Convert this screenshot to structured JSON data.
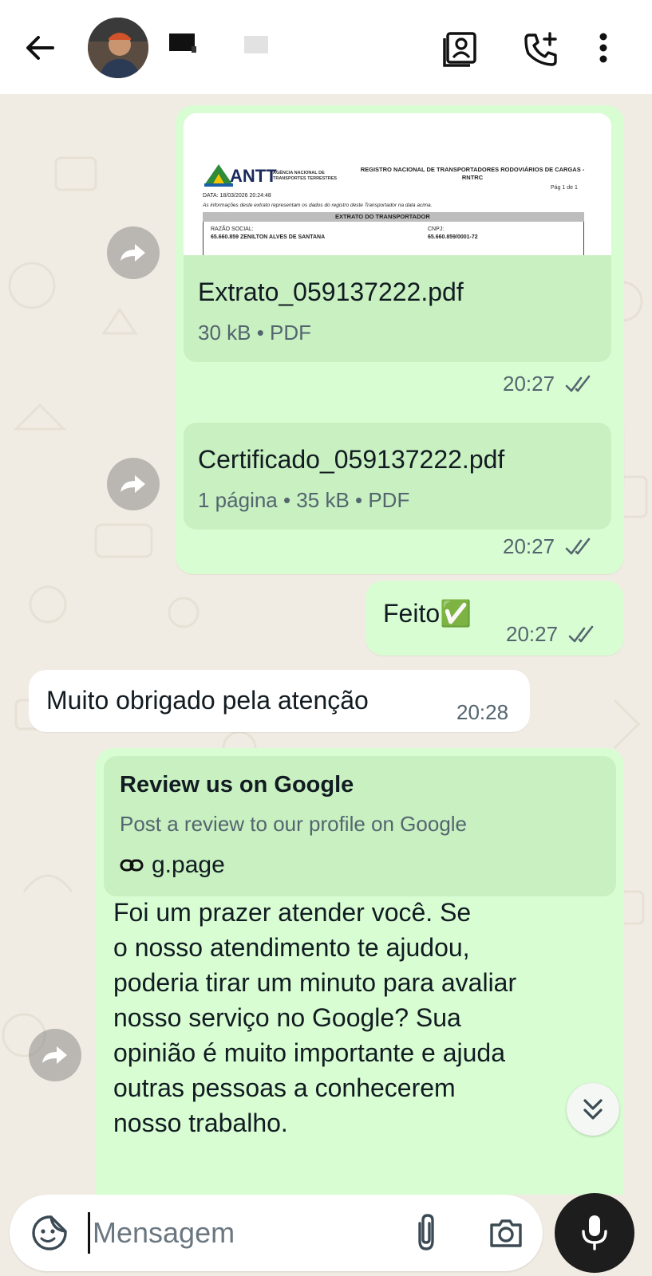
{
  "header": {
    "back_icon": "arrow-left-icon",
    "contact_icon": "contact-card-icon",
    "add_call_icon": "add-call-icon",
    "menu_icon": "more-vertical-icon"
  },
  "messages": {
    "doc1": {
      "preview": {
        "logo_text": "ANTT",
        "agency": "AGÊNCIA NACIONAL DE TRANSPORTES TERRESTRES",
        "registry_title": "REGISTRO NACIONAL DE TRANSPORTADORES RODOVIÁRIOS DE CARGAS - RNTRC",
        "page": "Pág 1 de 1",
        "date_line": "DATA: 18/03/2026 20:24:48",
        "note": "As informações deste extrato representam os dados do registro deste Transportador na data acima.",
        "section": "EXTRATO DO TRANSPORTADOR",
        "razao_label": "RAZÃO SOCIAL:",
        "razao_value": "65.660.859 ZENILTON ALVES DE SANTANA",
        "cnpj_label": "CNPJ:",
        "cnpj_value": "65.660.859/0001-72"
      },
      "filename": "Extrato_059137222.pdf",
      "meta": "30 kB • PDF",
      "time": "20:27"
    },
    "doc2": {
      "filename": "Certificado_059137222.pdf",
      "meta": "1 página • 35 kB • PDF",
      "time": "20:27"
    },
    "feito": {
      "text": "Feito✅",
      "time": "20:27"
    },
    "incoming": {
      "text": "Muito obrigado pela atenção",
      "time": "20:28"
    },
    "review": {
      "link_title": "Review us on Google",
      "link_desc": "Post a review to our profile on Google",
      "link_url": "g.page",
      "lines": [
        "Foi um prazer atender você. Se",
        "o nosso atendimento te ajudou,",
        "poderia tirar um minuto para avaliar",
        "nosso serviço no Google? Sua",
        "opinião é muito importante e ajuda",
        "outras pessoas a conhecerem",
        "nosso trabalho."
      ]
    }
  },
  "composer": {
    "placeholder": "Mensagem",
    "emoji_icon": "sticker-icon",
    "attach_icon": "paperclip-icon",
    "camera_icon": "camera-icon",
    "mic_icon": "microphone-icon"
  },
  "colors": {
    "outgoing_bubble": "#d8fdd2",
    "incoming_bubble": "#ffffff",
    "chat_background": "#f1ece3",
    "mic_button": "#1d1d1d"
  }
}
